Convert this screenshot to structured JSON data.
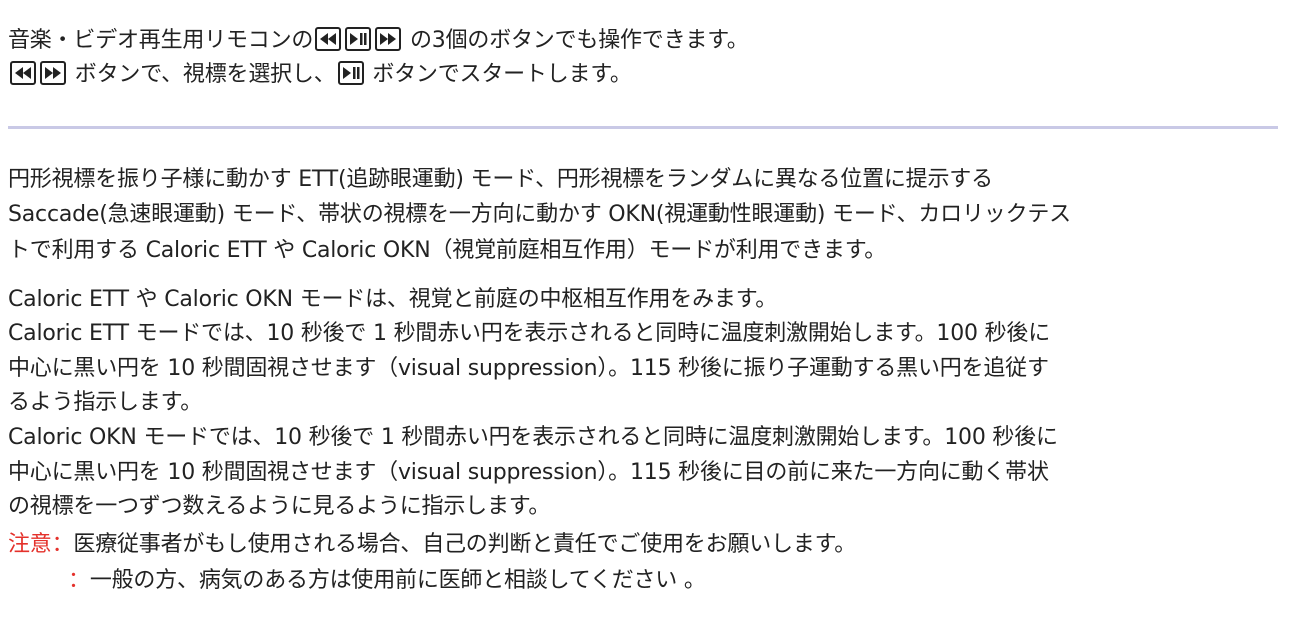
{
  "intro": {
    "line1_prefix": "音楽・ビデオ再生用リモコンの",
    "line1_suffix": "の3個のボタンでも操作できます。",
    "line2_middle": "ボタンで、視標を選択し、",
    "line2_suffix": "ボタンでスタートします。",
    "icons": [
      "rewind-icon",
      "play-pause-icon",
      "fast-forward-icon"
    ]
  },
  "body": {
    "p1_l1": "円形視標を振り子様に動かす ETT(追跡眼運動) モード、円形視標をランダムに異なる位置に提示する",
    "p1_l2": "Saccade(急速眼運動) モード、帯状の視標を一方向に動かす OKN(視運動性眼運動) モード、カロリックテス",
    "p1_l3": "トで利用する Caloric ETT や Caloric OKN（視覚前庭相互作用）モードが利用できます。",
    "p2_l1": "Caloric ETT や Caloric OKN モードは、視覚と前庭の中枢相互作用をみます。",
    "p3_l1": "Caloric ETT モードでは、10 秒後で 1 秒間赤い円を表示されると同時に温度刺激開始します。100 秒後に",
    "p3_l2": "中心に黒い円を 10 秒間固視させます（visual suppression）。115 秒後に振り子運動する黒い円を追従す",
    "p3_l3": "るよう指示します。",
    "p4_l1": "Caloric OKN モードでは、10 秒後で 1 秒間赤い円を表示されると同時に温度刺激開始します。100 秒後に",
    "p4_l2": "中心に黒い円を 10 秒間固視させます（visual suppression）。115 秒後に目の前に来た一方向に動く帯状",
    "p4_l3": "の視標を一つずつ数えるように見るように指示します。"
  },
  "notice": {
    "label": "注意：",
    "line1": "医療従事者がもし使用される場合、自己の判断と責任でご使用をお願いします。",
    "bullet2": "：",
    "line2": "一般の方、病気のある方は使用前に医師と相談してください 。"
  },
  "colors": {
    "text": "#222222",
    "divider": "#c9c9e6",
    "warning": "#e4312b"
  }
}
